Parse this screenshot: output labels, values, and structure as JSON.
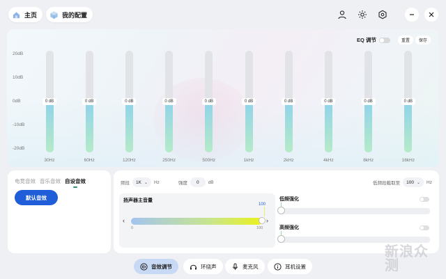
{
  "topbar": {
    "home_label": "主页",
    "config_label": "我的配置"
  },
  "eq": {
    "title": "EQ 调节",
    "reset_label": "重置",
    "save_label": "保存",
    "y_labels": [
      "20dB",
      "10dB",
      "0dB",
      "-10dB",
      "-20dB"
    ],
    "bands": [
      {
        "label": "30Hz",
        "value": "0 dB"
      },
      {
        "label": "60Hz",
        "value": "0 dB"
      },
      {
        "label": "120Hz",
        "value": "0 dB"
      },
      {
        "label": "250Hz",
        "value": "0 dB"
      },
      {
        "label": "500Hz",
        "value": "0 dB"
      },
      {
        "label": "1kHz",
        "value": "0 dB"
      },
      {
        "label": "2kHz",
        "value": "0 dB"
      },
      {
        "label": "4kHz",
        "value": "0 dB"
      },
      {
        "label": "8kHz",
        "value": "0 dB"
      },
      {
        "label": "16kHz",
        "value": "0 dB"
      }
    ]
  },
  "presets": {
    "tabs": [
      "电竞音效",
      "音乐音效",
      "自设音效"
    ],
    "active_tab": 2,
    "default_button": "默认音效"
  },
  "controls": {
    "freq_label": "频段",
    "freq_value": "1K",
    "freq_unit": "Hz",
    "gain_label": "强度",
    "gain_value": "0",
    "gain_unit": "dB",
    "lowcut_label": "低频段截取至",
    "lowcut_value": "100",
    "lowcut_unit": "Hz"
  },
  "volume": {
    "title": "扬声器主音量",
    "value": "100",
    "min": "0",
    "max": "100",
    "level": 1.0
  },
  "bass": {
    "title": "低频强化",
    "value": "0"
  },
  "treble": {
    "title": "高频强化",
    "value": "0"
  },
  "nav": {
    "items": [
      "音效调节",
      "环绕声",
      "麦克风",
      "耳机设置"
    ],
    "active": 0
  },
  "watermark": "新浪众测"
}
